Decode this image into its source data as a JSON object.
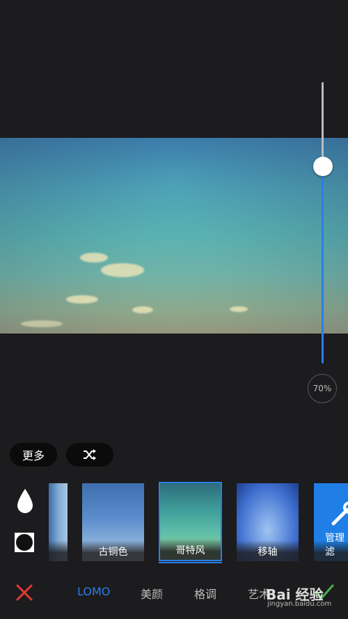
{
  "editor": {
    "intensity_value": 0.7,
    "intensity_label": "70%"
  },
  "actions": {
    "more_label": "更多",
    "shuffle_icon": "shuffle-icon"
  },
  "tools": {
    "drop_icon": "drop-icon",
    "frame_icon": "square-frame-icon"
  },
  "filters": [
    {
      "label": "",
      "selected": false
    },
    {
      "label": "古铜色",
      "selected": false
    },
    {
      "label": "哥特风",
      "selected": true
    },
    {
      "label": "移轴",
      "selected": false
    },
    {
      "label": "管理滤",
      "selected": false
    }
  ],
  "tabs": [
    {
      "label": "LOMO",
      "active": true
    },
    {
      "label": "美颜",
      "active": false
    },
    {
      "label": "格调",
      "active": false
    },
    {
      "label": "艺术",
      "active": false
    }
  ],
  "watermark": {
    "brand": "Bai 经验",
    "sub": "jingyan.baidu.com"
  },
  "colors": {
    "accent": "#2a7fe8",
    "cancel": "#e53935",
    "confirm": "#4caf50",
    "background": "#1c1b1d"
  }
}
